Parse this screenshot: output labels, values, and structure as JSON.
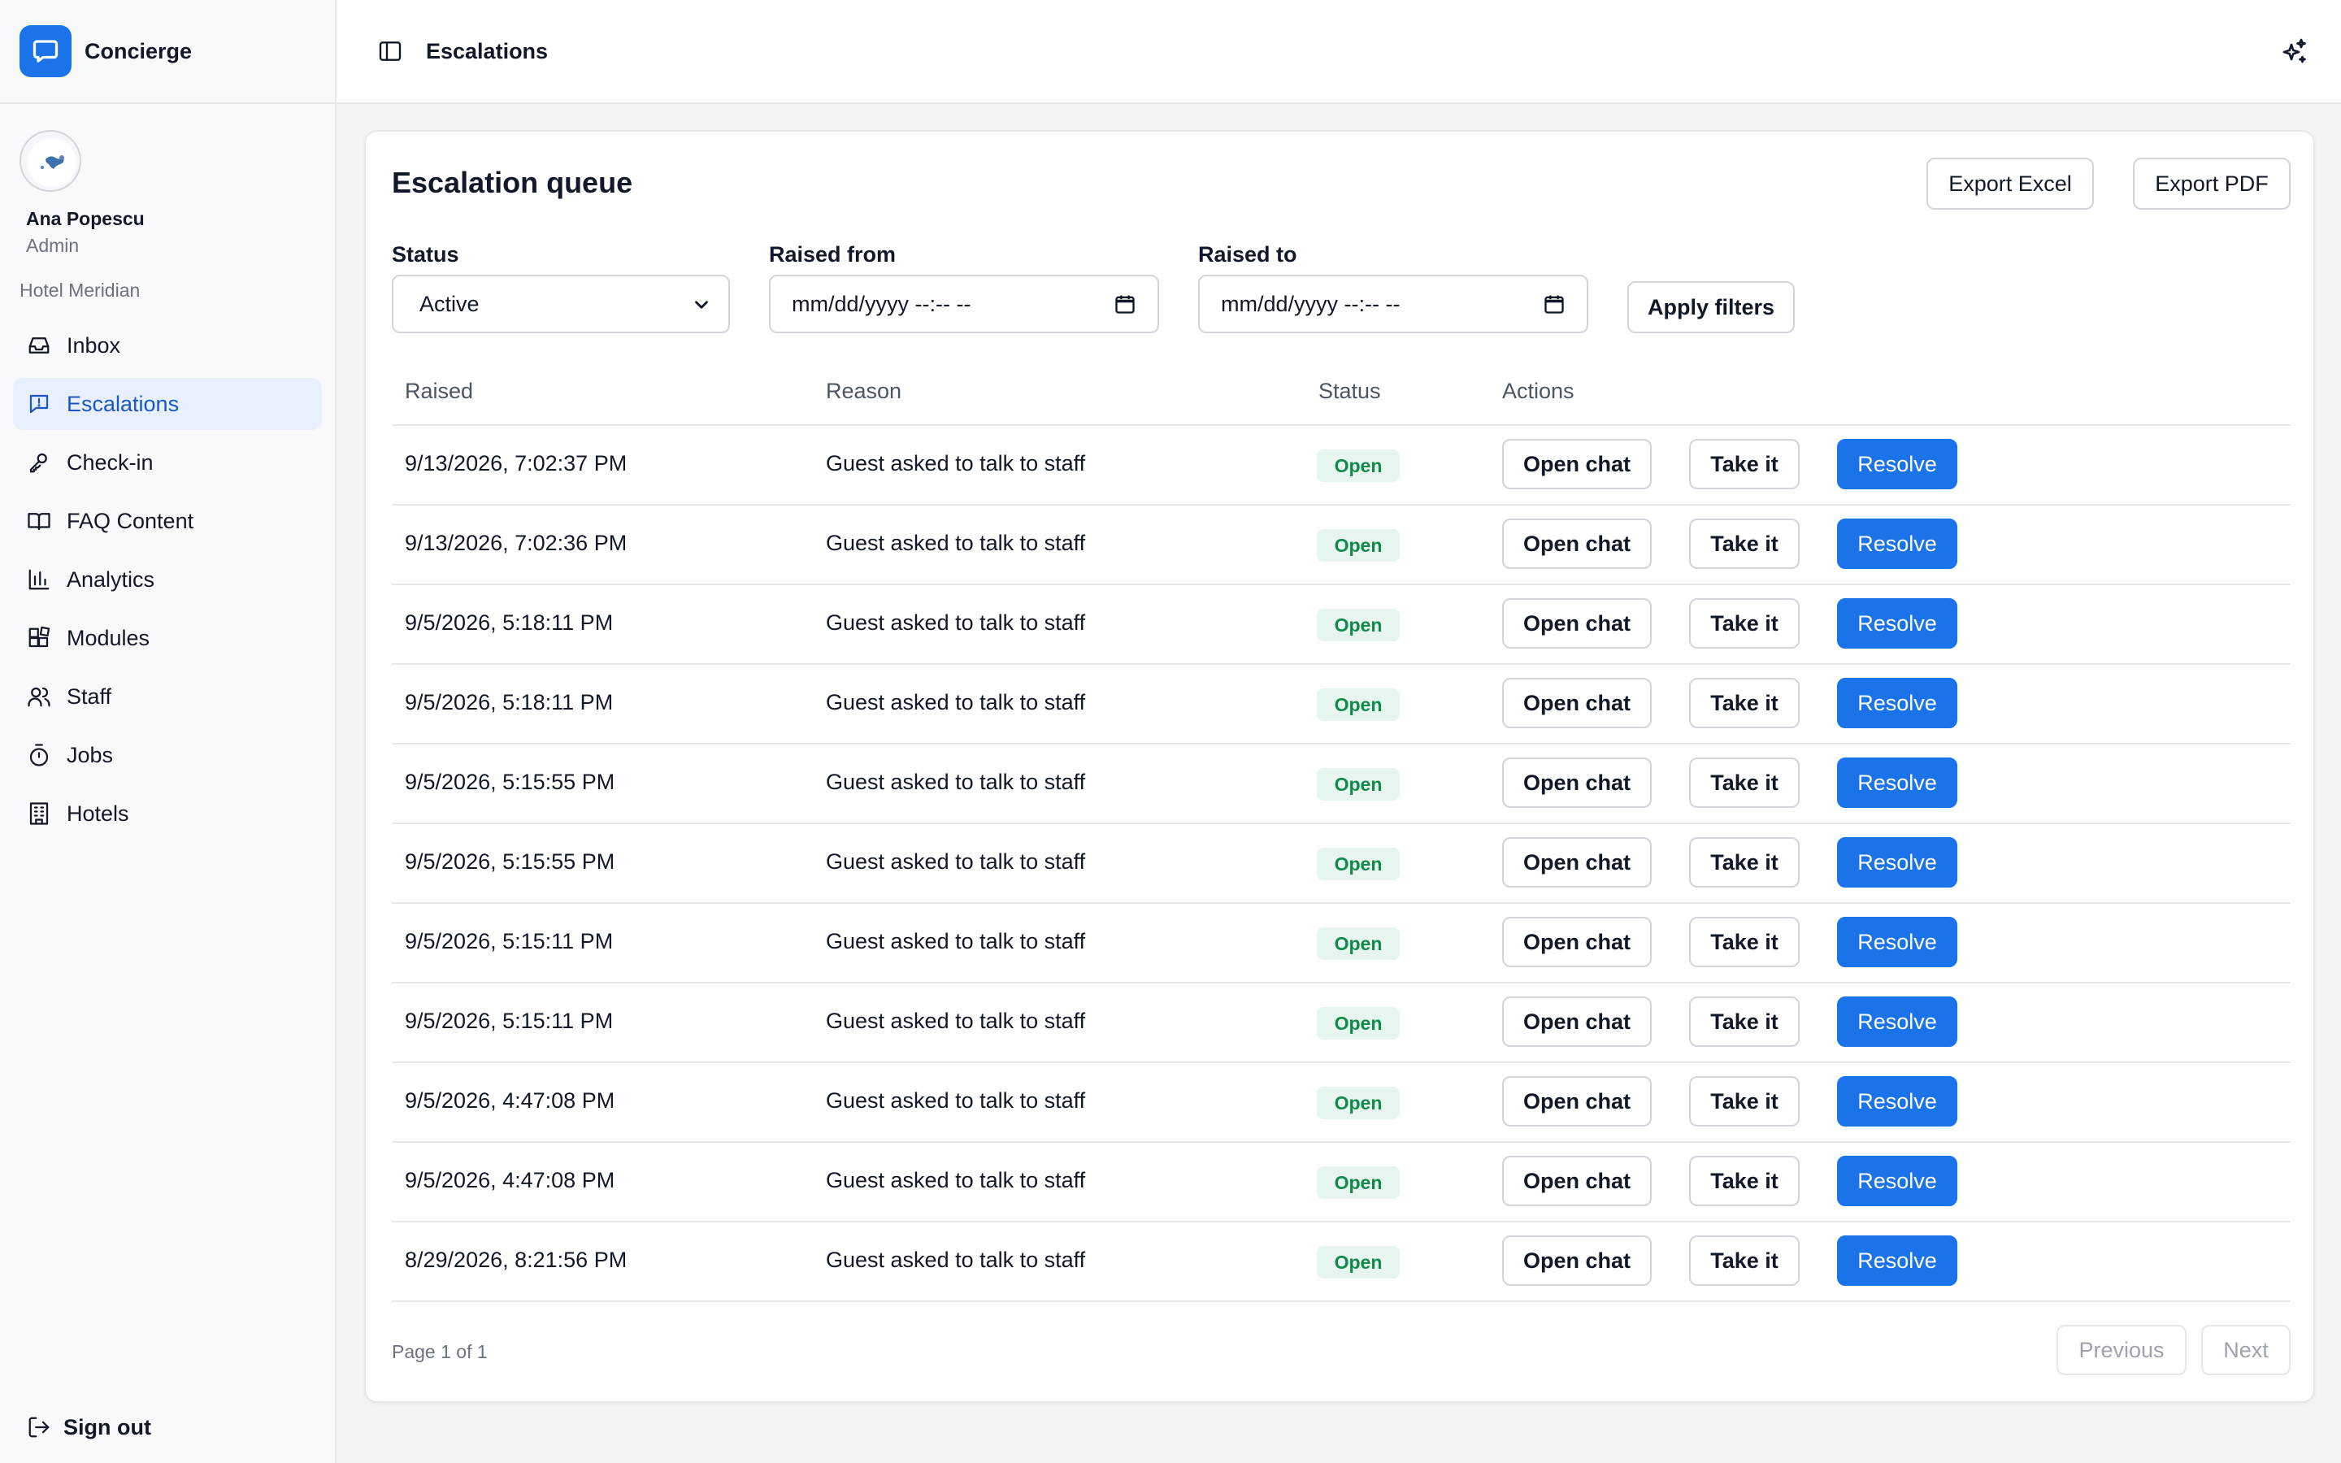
{
  "app": {
    "name": "Concierge",
    "brand_color": "#1a73e8"
  },
  "user": {
    "name": "Ana Popescu",
    "role": "Admin",
    "hotel": "Hotel Meridian"
  },
  "sidebar": {
    "items": [
      {
        "label": "Inbox",
        "icon": "inbox-icon",
        "active": false
      },
      {
        "label": "Escalations",
        "icon": "alert-message-icon",
        "active": true
      },
      {
        "label": "Check-in",
        "icon": "key-icon",
        "active": false
      },
      {
        "label": "FAQ Content",
        "icon": "book-icon",
        "active": false
      },
      {
        "label": "Analytics",
        "icon": "bar-chart-icon",
        "active": false
      },
      {
        "label": "Modules",
        "icon": "modules-icon",
        "active": false
      },
      {
        "label": "Staff",
        "icon": "users-icon",
        "active": false
      },
      {
        "label": "Jobs",
        "icon": "timer-icon",
        "active": false
      },
      {
        "label": "Hotels",
        "icon": "building-icon",
        "active": false
      }
    ],
    "sign_out": "Sign out"
  },
  "topbar": {
    "title": "Escalations"
  },
  "card": {
    "title": "Escalation queue",
    "export_excel": "Export Excel",
    "export_pdf": "Export PDF"
  },
  "filters": {
    "status_label": "Status",
    "status_value": "Active",
    "raised_from_label": "Raised from",
    "raised_from_placeholder": "mm/dd/yyyy --:-- --",
    "raised_to_label": "Raised to",
    "raised_to_placeholder": "mm/dd/yyyy --:-- --",
    "apply": "Apply filters"
  },
  "table": {
    "columns": [
      "Raised",
      "Reason",
      "Status",
      "Actions"
    ],
    "actions": {
      "open": "Open chat",
      "take": "Take it",
      "resolve": "Resolve"
    },
    "rows": [
      {
        "raised": "9/13/2026, 7:02:37 PM",
        "reason": "Guest asked to talk to staff",
        "status": "Open"
      },
      {
        "raised": "9/13/2026, 7:02:36 PM",
        "reason": "Guest asked to talk to staff",
        "status": "Open"
      },
      {
        "raised": "9/5/2026, 5:18:11 PM",
        "reason": "Guest asked to talk to staff",
        "status": "Open"
      },
      {
        "raised": "9/5/2026, 5:18:11 PM",
        "reason": "Guest asked to talk to staff",
        "status": "Open"
      },
      {
        "raised": "9/5/2026, 5:15:55 PM",
        "reason": "Guest asked to talk to staff",
        "status": "Open"
      },
      {
        "raised": "9/5/2026, 5:15:55 PM",
        "reason": "Guest asked to talk to staff",
        "status": "Open"
      },
      {
        "raised": "9/5/2026, 5:15:11 PM",
        "reason": "Guest asked to talk to staff",
        "status": "Open"
      },
      {
        "raised": "9/5/2026, 5:15:11 PM",
        "reason": "Guest asked to talk to staff",
        "status": "Open"
      },
      {
        "raised": "9/5/2026, 4:47:08 PM",
        "reason": "Guest asked to talk to staff",
        "status": "Open"
      },
      {
        "raised": "9/5/2026, 4:47:08 PM",
        "reason": "Guest asked to talk to staff",
        "status": "Open"
      },
      {
        "raised": "8/29/2026, 8:21:56 PM",
        "reason": "Guest asked to talk to staff",
        "status": "Open"
      }
    ]
  },
  "pagination": {
    "info": "Page 1 of 1",
    "previous": "Previous",
    "next": "Next"
  }
}
